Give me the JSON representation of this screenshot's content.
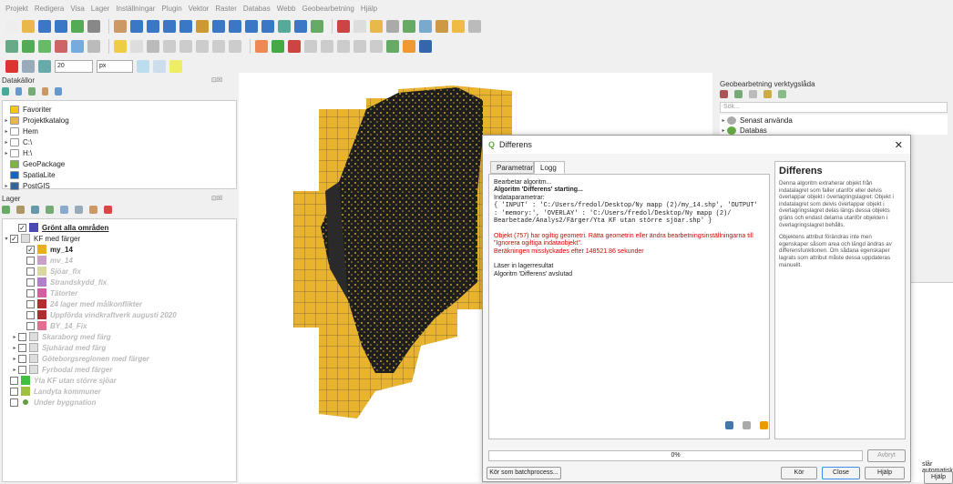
{
  "menubar": [
    "Projekt",
    "Redigera",
    "Visa",
    "Lager",
    "Inställningar",
    "Plugin",
    "Vektor",
    "Raster",
    "Databas",
    "Webb",
    "Geobearbetning",
    "Hjälp"
  ],
  "toolbar3": {
    "size_value": "20",
    "unit_value": "px"
  },
  "browser_panel": {
    "title": "Datakällor",
    "items": [
      {
        "label": "Favoriter",
        "icon": "star-icon",
        "color": "#f5c518",
        "expand": ""
      },
      {
        "label": "Projektkatalog",
        "icon": "folder-icon",
        "color": "#e8b64a",
        "expand": "▸"
      },
      {
        "label": "Hem",
        "icon": "home-icon",
        "color": "#ffffff",
        "expand": "▸"
      },
      {
        "label": "C:\\",
        "icon": "drive-icon",
        "color": "#ffffff",
        "expand": "▸"
      },
      {
        "label": "H:\\",
        "icon": "drive-icon",
        "color": "#ffffff",
        "expand": "▸"
      },
      {
        "label": "GeoPackage",
        "icon": "geopackage-icon",
        "color": "#7cb342",
        "expand": ""
      },
      {
        "label": "SpatiaLite",
        "icon": "feather-icon",
        "color": "#1565c0",
        "expand": ""
      },
      {
        "label": "PostGIS",
        "icon": "elephant-icon",
        "color": "#336699",
        "expand": "▸"
      }
    ]
  },
  "layers_panel": {
    "title": "Lager",
    "items": [
      {
        "label": "Grönt alla områden",
        "checked": true,
        "color": "#4a4ab0",
        "style": "bold-underline",
        "indent": 1,
        "expand": ""
      },
      {
        "label": "KF med färger",
        "checked": true,
        "color": "",
        "style": "normal",
        "indent": 0,
        "expand": "▾",
        "group": true
      },
      {
        "label": "my_14",
        "checked": true,
        "color": "#e8b020",
        "style": "bold",
        "indent": 2,
        "expand": ""
      },
      {
        "label": "mv_14",
        "checked": false,
        "color": "#c8a0c8",
        "style": "italic",
        "indent": 2,
        "expand": ""
      },
      {
        "label": "Sjöar_fix",
        "checked": false,
        "color": "#d8d8a0",
        "style": "italic",
        "indent": 2,
        "expand": ""
      },
      {
        "label": "Strandskydd_fix",
        "checked": false,
        "color": "#b080c8",
        "style": "italic",
        "indent": 2,
        "expand": ""
      },
      {
        "label": "Tätorter",
        "checked": false,
        "color": "#d060a0",
        "style": "italic",
        "indent": 2,
        "expand": ""
      },
      {
        "label": "24 lager med målkonflikter",
        "checked": false,
        "color": "#b03030",
        "style": "italic",
        "indent": 2,
        "expand": ""
      },
      {
        "label": "Uppförda vindkraftverk augusti 2020",
        "checked": false,
        "color": "#a83030",
        "style": "italic",
        "indent": 2,
        "expand": ""
      },
      {
        "label": "BY_14_Fix",
        "checked": false,
        "color": "#e07090",
        "style": "italic",
        "indent": 2,
        "expand": ""
      },
      {
        "label": "Skaraborg med färg",
        "checked": false,
        "color": "",
        "style": "italic",
        "indent": 1,
        "expand": "▸",
        "group": true
      },
      {
        "label": "Sjuhärad med färg",
        "checked": false,
        "color": "",
        "style": "italic",
        "indent": 1,
        "expand": "▸",
        "group": true
      },
      {
        "label": "Göteborgsregionen med färger",
        "checked": false,
        "color": "",
        "style": "italic",
        "indent": 1,
        "expand": "▸",
        "group": true
      },
      {
        "label": "Fyrbodal med färger",
        "checked": false,
        "color": "",
        "style": "italic",
        "indent": 1,
        "expand": "▸",
        "group": true
      },
      {
        "label": "Yta KF utan större sjöar",
        "checked": false,
        "color": "#40c040",
        "style": "italic",
        "indent": 0,
        "expand": ""
      },
      {
        "label": "Landyta kommuner",
        "checked": false,
        "color": "#a0c040",
        "style": "italic",
        "indent": 0,
        "expand": ""
      },
      {
        "label": "Under byggnation",
        "checked": false,
        "color": "#60a040",
        "style": "italic",
        "indent": 0,
        "expand": "",
        "point": true
      }
    ]
  },
  "geoproc": {
    "title": "Geobearbetning verktygslåda",
    "search_placeholder": "Sök...",
    "items": [
      {
        "label": "Senast använda",
        "icon": "clock-icon"
      },
      {
        "label": "Databas",
        "icon": "database-icon"
      }
    ],
    "auto_text": "slår automatiskt",
    "help_btn": "Hjälp"
  },
  "dialog": {
    "title": "Differens",
    "tabs": [
      "Parametrar",
      "Logg"
    ],
    "log": [
      {
        "text": "Bearbetar algoritm...",
        "cls": ""
      },
      {
        "text": "Algoritm 'Differens' starting...",
        "cls": "bold"
      },
      {
        "text": "Indataparametrar:",
        "cls": ""
      },
      {
        "text": "{ 'INPUT' : 'C:/Users/fredol/Desktop/Ny mapp (2)/my_14.shp', 'OUTPUT' : 'memory:', 'OVERLAY' : 'C:/Users/fredol/Desktop/Ny mapp (2)/ Bearbetade/Analys2/Färger/Yta KF utan större sjöar.shp' }",
        "cls": "mono"
      },
      {
        "text": " ",
        "cls": ""
      },
      {
        "text": "Objekt (757) har ogiltig geometri. Rätta geometrin eller ändra bearbetningsinställningarna till \"Ignorera ogiltiga indataobjekt\".",
        "cls": "red"
      },
      {
        "text": "Beräkningen misslyckades efter 148521.86 sekunder",
        "cls": "red"
      },
      {
        "text": " ",
        "cls": ""
      },
      {
        "text": "Läser in lagerresultat",
        "cls": ""
      },
      {
        "text": "Algoritm 'Differens' avslutad",
        "cls": ""
      }
    ],
    "help_title": "Differens",
    "help_p1": "Denna algoritm extraherar objekt från indatalagret som faller utanför eller delvis överlappar objekt i överlagringslagret. Objekt i indatalagret som delvis överlappar objekt i överlagringslagret delas längs dessa objekts gräns och endast delarna utanför objekten i överlagringslagret behålls.",
    "help_p2": "Objektens attribut förändras inte men egenskaper såsom area och längd ändras av differensfunktionen. Om sådana egenskaper lagrats som attribut måste dessa uppdateras manuellt.",
    "progress": "0%",
    "progress_value": 0,
    "btn_batch": "Kör som batchprocess...",
    "btn_run": "Kör",
    "btn_close": "Close",
    "btn_help": "Hjälp",
    "btn_cancel": "Avbryt"
  },
  "colors": {
    "map_fill": "#e8b430",
    "map_dark": "#222222",
    "accent": "#3c8ee6"
  }
}
